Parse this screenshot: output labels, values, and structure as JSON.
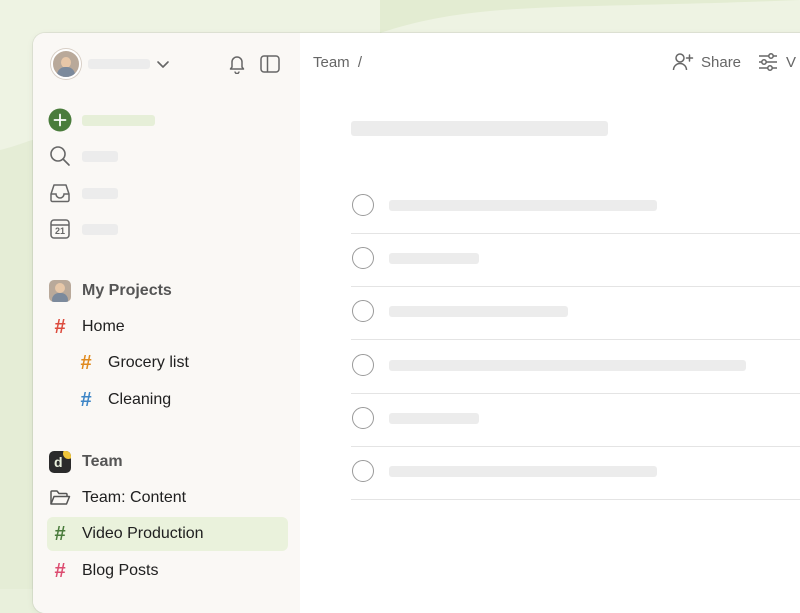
{
  "breadcrumb": {
    "project": "Team",
    "separator": "/"
  },
  "toolbar": {
    "share_label": "Share",
    "view_label": "V"
  },
  "sidebar": {
    "icons": [
      "notification-bell-icon",
      "sidebar-toggle-icon",
      "add-task-icon",
      "search-icon",
      "inbox-icon",
      "calendar-icon"
    ],
    "calendar_day": "21",
    "my_projects": {
      "title": "My Projects",
      "items": [
        {
          "label": "Home",
          "color": "#dc4c3e"
        },
        {
          "label": "Grocery list",
          "color": "#e08a1e"
        },
        {
          "label": "Cleaning",
          "color": "#3d85c6"
        }
      ]
    },
    "team": {
      "title": "Team",
      "logo_letter": "d",
      "items": [
        {
          "label": "Team: Content",
          "icon": "folder-icon"
        },
        {
          "label": "Video Production",
          "color": "#4a7c3c",
          "active": true
        },
        {
          "label": "Blog Posts",
          "color": "#dc4c70"
        }
      ]
    }
  },
  "colors": {
    "accent": "#4a7c3c",
    "active_bg": "#eaf2dc",
    "sidebar_bg": "#faf8f5"
  }
}
